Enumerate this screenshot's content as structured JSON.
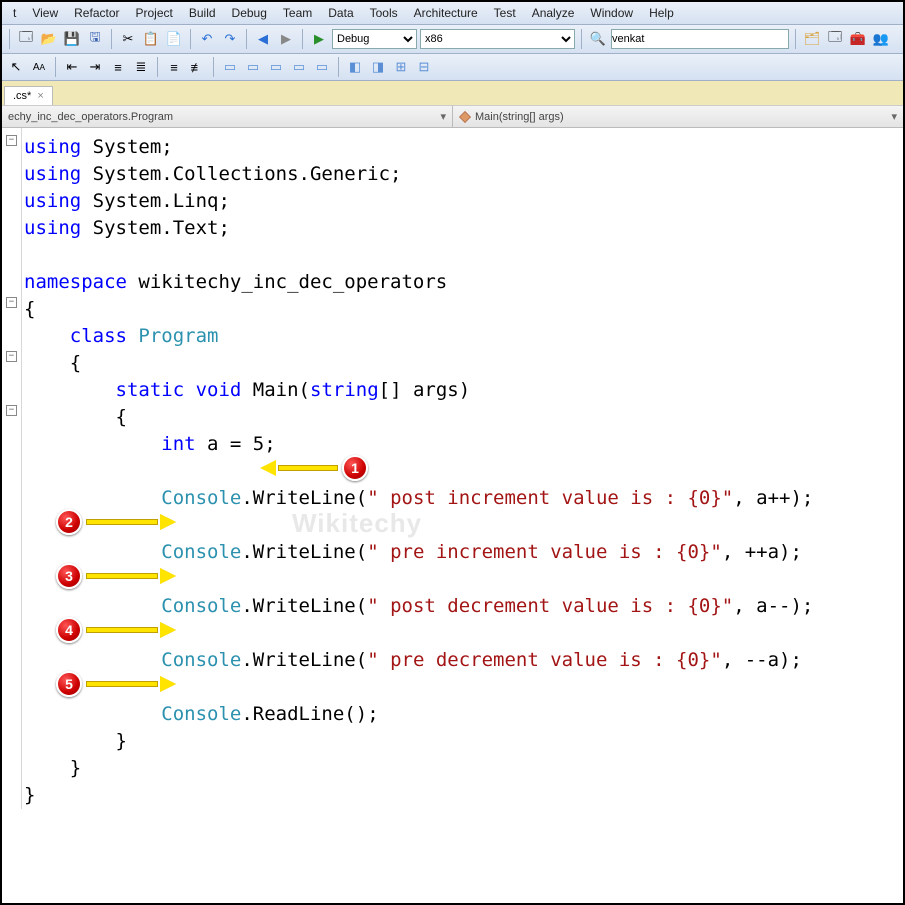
{
  "menu": [
    "t",
    "View",
    "Refactor",
    "Project",
    "Build",
    "Debug",
    "Team",
    "Data",
    "Tools",
    "Architecture",
    "Test",
    "Analyze",
    "Window",
    "Help"
  ],
  "toolbar": {
    "config": "Debug",
    "platform": "x86",
    "search": "venkat"
  },
  "tab": {
    "filename": ".cs*"
  },
  "nav": {
    "leftClass": "echy_inc_dec_operators.Program",
    "rightMethod": "Main(string[] args)"
  },
  "code": {
    "l1": {
      "kw": "using",
      "rest": " System;"
    },
    "l2": {
      "kw": "using",
      "rest": " System.Collections.Generic;"
    },
    "l3": {
      "kw": "using",
      "rest": " System.Linq;"
    },
    "l4": {
      "kw": "using",
      "rest": " System.Text;"
    },
    "l6": {
      "kw": "namespace",
      "rest": " wikitechy_inc_dec_operators"
    },
    "l7": "{",
    "l8": {
      "indent": "    ",
      "kw": "class",
      "type": " Program"
    },
    "l9": "    {",
    "l10": {
      "indent": "        ",
      "kw1": "static",
      "kw2": " void",
      "rest": " Main(",
      "kw3": "string",
      "rest2": "[] args)"
    },
    "l11": "        {",
    "l12": {
      "indent": "            ",
      "kw": "int",
      "rest": " a = 5;"
    },
    "l14": {
      "indent": "            ",
      "type": "Console",
      "rest": ".WriteLine(",
      "str": "\" post increment value is : {0}\"",
      "rest2": ", a++);"
    },
    "l16": {
      "indent": "            ",
      "type": "Console",
      "rest": ".WriteLine(",
      "str": "\" pre increment value is : {0}\"",
      "rest2": ", ++a);"
    },
    "l18": {
      "indent": "            ",
      "type": "Console",
      "rest": ".WriteLine(",
      "str": "\" post decrement value is : {0}\"",
      "rest2": ", a--);"
    },
    "l20": {
      "indent": "            ",
      "type": "Console",
      "rest": ".WriteLine(",
      "str": "\" pre decrement value is : {0}\"",
      "rest2": ", --a);"
    },
    "l22": {
      "indent": "            ",
      "type": "Console",
      "rest": ".ReadLine();"
    },
    "l23": "        }",
    "l24": "    }",
    "l25": "}"
  },
  "badges": {
    "b1": "1",
    "b2": "2",
    "b3": "3",
    "b4": "4",
    "b5": "5"
  },
  "watermark": "Wikitechy"
}
